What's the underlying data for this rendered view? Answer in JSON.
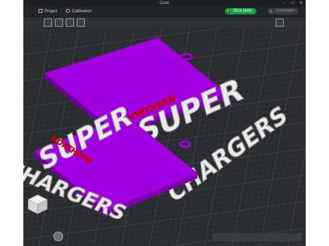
{
  "window": {
    "title": "Color"
  },
  "menu": {
    "project_label": "Project",
    "calibration_label": "Calibration"
  },
  "actions": {
    "slice_label": "Slice plate",
    "print_label": "Print plate"
  },
  "model": {
    "text_super": "SUPER",
    "text_northern": "NORTHERN",
    "text_chargers": "CHARGERS"
  },
  "colors": {
    "accent": "#16a34a",
    "purple": "#a100e0",
    "red": "#e00000",
    "white_part": "#e8e8e8"
  }
}
